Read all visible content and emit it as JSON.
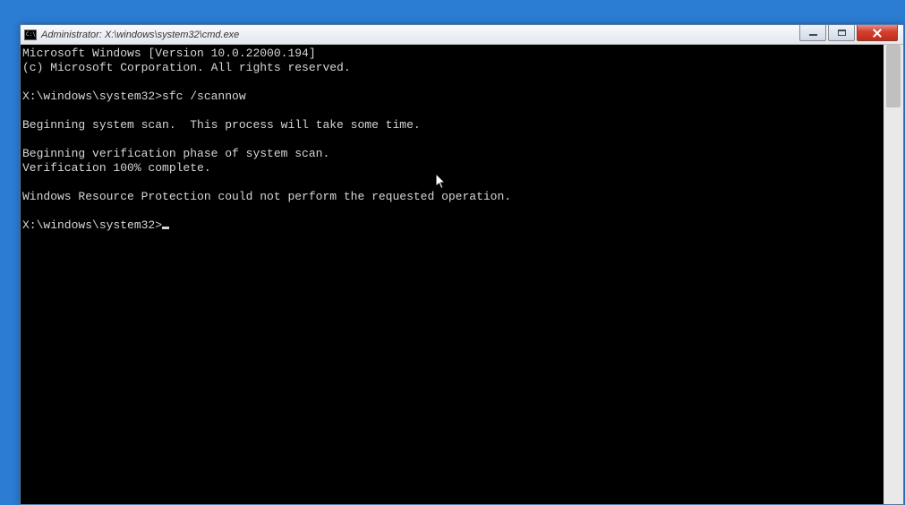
{
  "window": {
    "title": "Administrator: X:\\windows\\system32\\cmd.exe"
  },
  "terminal": {
    "lines": [
      "Microsoft Windows [Version 10.0.22000.194]",
      "(c) Microsoft Corporation. All rights reserved.",
      "",
      "X:\\windows\\system32>sfc /scannow",
      "",
      "Beginning system scan.  This process will take some time.",
      "",
      "Beginning verification phase of system scan.",
      "Verification 100% complete.",
      "",
      "Windows Resource Protection could not perform the requested operation.",
      ""
    ],
    "prompt": "X:\\windows\\system32>"
  }
}
